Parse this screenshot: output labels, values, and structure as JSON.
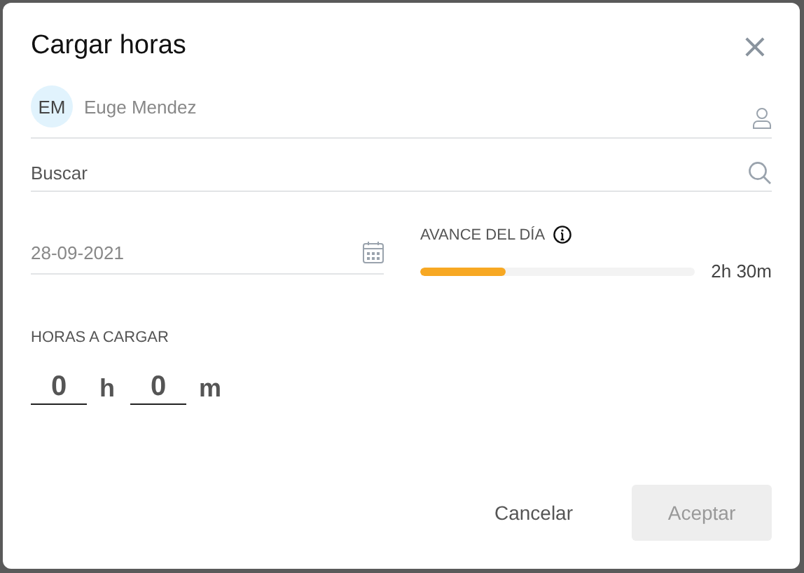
{
  "dialog": {
    "title": "Cargar horas",
    "close": "×"
  },
  "person": {
    "initials": "EM",
    "value": "Euge Mendez"
  },
  "search": {
    "placeholder": "Buscar"
  },
  "date": {
    "value": "28-09-2021"
  },
  "progress": {
    "label": "AVANCE DEL DÍA",
    "level": 0.31,
    "reading": "2h 30m"
  },
  "hours": {
    "label": "HORAS A CARGAR",
    "hours_value": "0",
    "hours_unit": "h",
    "minutes_value": "0",
    "minutes_unit": "m"
  },
  "buttons": [
    {
      "label": "Cancelar",
      "kind": "text",
      "disabled": false
    },
    {
      "label": "Aceptar",
      "kind": "filled",
      "disabled": true
    }
  ]
}
